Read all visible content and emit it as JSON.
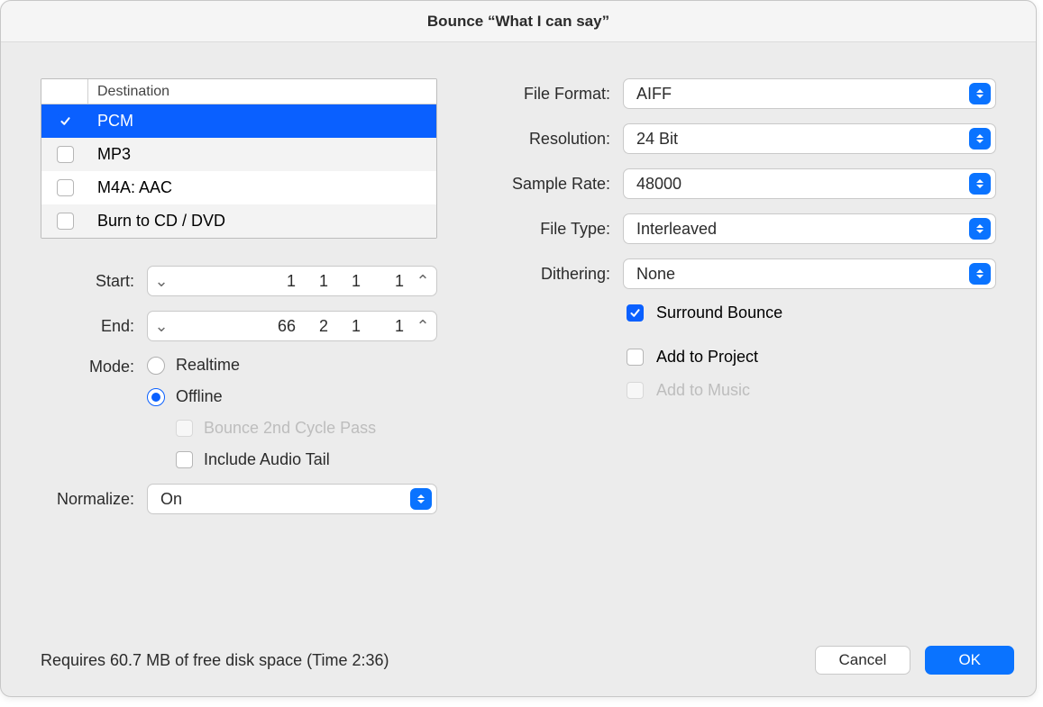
{
  "title": "Bounce “What I can say”",
  "footer": {
    "status": "Requires 60.7 MB of free disk space  (Time 2:36)",
    "cancel": "Cancel",
    "ok": "OK"
  },
  "destination": {
    "header": "Destination",
    "items": [
      {
        "label": "PCM",
        "checked": true,
        "selected": true
      },
      {
        "label": "MP3",
        "checked": false,
        "selected": false
      },
      {
        "label": "M4A: AAC",
        "checked": false,
        "selected": false
      },
      {
        "label": "Burn to CD / DVD",
        "checked": false,
        "selected": false
      }
    ]
  },
  "start": {
    "label": "Start:",
    "values": [
      "1",
      "1",
      "1",
      "1"
    ]
  },
  "end": {
    "label": "End:",
    "values": [
      "66",
      "2",
      "1",
      "1"
    ]
  },
  "mode": {
    "label": "Mode:",
    "realtime": "Realtime",
    "offline": "Offline",
    "second_pass": "Bounce 2nd Cycle Pass",
    "include_tail": "Include Audio Tail",
    "selected": "offline",
    "second_pass_enabled": false,
    "include_tail_checked": false
  },
  "normalize": {
    "label": "Normalize:",
    "value": "On"
  },
  "format": {
    "file_format_label": "File Format:",
    "file_format": "AIFF",
    "resolution_label": "Resolution:",
    "resolution": "24 Bit",
    "sample_rate_label": "Sample Rate:",
    "sample_rate": "48000",
    "file_type_label": "File Type:",
    "file_type": "Interleaved",
    "dithering_label": "Dithering:",
    "dithering": "None"
  },
  "options": {
    "surround_bounce": {
      "label": "Surround Bounce",
      "checked": true
    },
    "add_to_project": {
      "label": "Add to Project",
      "checked": false
    },
    "add_to_music": {
      "label": "Add to Music",
      "checked": false,
      "disabled": true
    }
  }
}
